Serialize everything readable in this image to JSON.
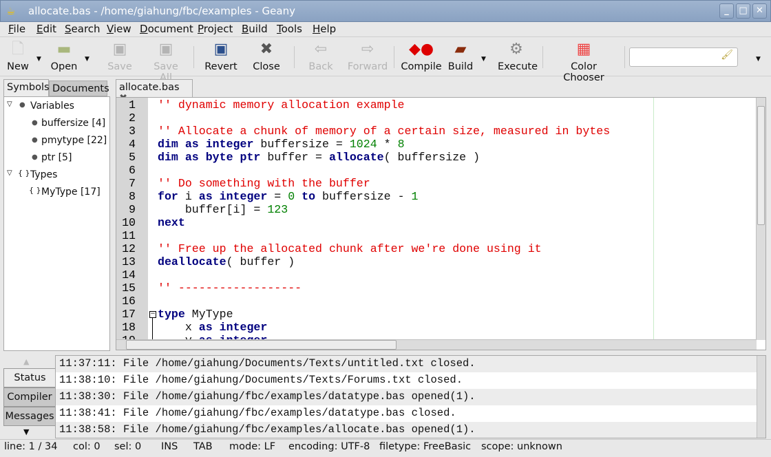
{
  "window": {
    "title": "allocate.bas - /home/giahung/fbc/examples - Geany",
    "minimize": "_",
    "maximize": "□",
    "close": "✕"
  },
  "menu": [
    "File",
    "Edit",
    "Search",
    "View",
    "Document",
    "Project",
    "Build",
    "Tools",
    "Help"
  ],
  "toolbar": {
    "new": "New",
    "open": "Open",
    "save": "Save",
    "save_all": "Save All",
    "revert": "Revert",
    "close": "Close",
    "back": "Back",
    "forward": "Forward",
    "compile": "Compile",
    "build": "Build",
    "execute": "Execute",
    "color_chooser": "Color Chooser",
    "search_value": ""
  },
  "sidebar": {
    "tabs": [
      "Symbols",
      "Documents"
    ],
    "active_tab": "Symbols",
    "tree": [
      {
        "label": "Variables",
        "children": [
          "buffersize [4]",
          "pmytype [22]",
          "ptr [5]"
        ]
      },
      {
        "label": "Types",
        "children": [
          "MyType [17]"
        ]
      }
    ]
  },
  "editor": {
    "tab": "allocate.bas",
    "lines": [
      [
        [
          "comment",
          "'' dynamic memory allocation example"
        ]
      ],
      [],
      [
        [
          "comment",
          "'' Allocate a chunk of memory of a certain size, measured in bytes"
        ]
      ],
      [
        [
          "kw",
          "dim as integer"
        ],
        [
          "plain",
          " buffersize = "
        ],
        [
          "num",
          "1024"
        ],
        [
          "plain",
          " * "
        ],
        [
          "num",
          "8"
        ]
      ],
      [
        [
          "kw",
          "dim as byte ptr"
        ],
        [
          "plain",
          " buffer = "
        ],
        [
          "kw",
          "allocate"
        ],
        [
          "plain",
          "( buffersize )"
        ]
      ],
      [],
      [
        [
          "comment",
          "'' Do something with the buffer"
        ]
      ],
      [
        [
          "kw",
          "for"
        ],
        [
          "plain",
          " i "
        ],
        [
          "kw",
          "as integer"
        ],
        [
          "plain",
          " = "
        ],
        [
          "num",
          "0"
        ],
        [
          "plain",
          " "
        ],
        [
          "kw",
          "to"
        ],
        [
          "plain",
          " buffersize - "
        ],
        [
          "num",
          "1"
        ]
      ],
      [
        [
          "plain",
          "    buffer[i] = "
        ],
        [
          "num",
          "123"
        ]
      ],
      [
        [
          "kw",
          "next"
        ]
      ],
      [],
      [
        [
          "comment",
          "'' Free up the allocated chunk after we're done using it"
        ]
      ],
      [
        [
          "kw",
          "deallocate"
        ],
        [
          "plain",
          "( buffer )"
        ]
      ],
      [],
      [
        [
          "comment",
          "'' ------------------"
        ]
      ],
      [],
      [
        [
          "kw",
          "type"
        ],
        [
          "plain",
          " MyType"
        ]
      ],
      [
        [
          "plain",
          "    x "
        ],
        [
          "kw",
          "as integer"
        ]
      ],
      [
        [
          "plain",
          "    y "
        ],
        [
          "kw",
          "as integer"
        ]
      ]
    ]
  },
  "messages": {
    "tabs": [
      "Status",
      "Compiler",
      "Messages"
    ],
    "active_tab": "Status",
    "lines": [
      "11:37:11: File /home/giahung/Documents/Texts/untitled.txt closed.",
      "11:38:10: File /home/giahung/Documents/Texts/Forums.txt closed.",
      "11:38:30: File /home/giahung/fbc/examples/datatype.bas opened(1).",
      "11:38:41: File /home/giahung/fbc/examples/datatype.bas closed.",
      "11:38:58: File /home/giahung/fbc/examples/allocate.bas opened(1)."
    ]
  },
  "status": {
    "line": "line: 1 / 34",
    "col": "col: 0",
    "sel": "sel: 0",
    "mode_ins": "INS",
    "indent": "TAB",
    "eol": "mode: LF",
    "encoding": "encoding: UTF-8",
    "filetype": "filetype: FreeBasic",
    "scope": "scope: unknown"
  },
  "colors": {
    "comment": "#e00000",
    "keyword": "#00007f",
    "number": "#008000",
    "titlebar": "#8aa2c2"
  }
}
